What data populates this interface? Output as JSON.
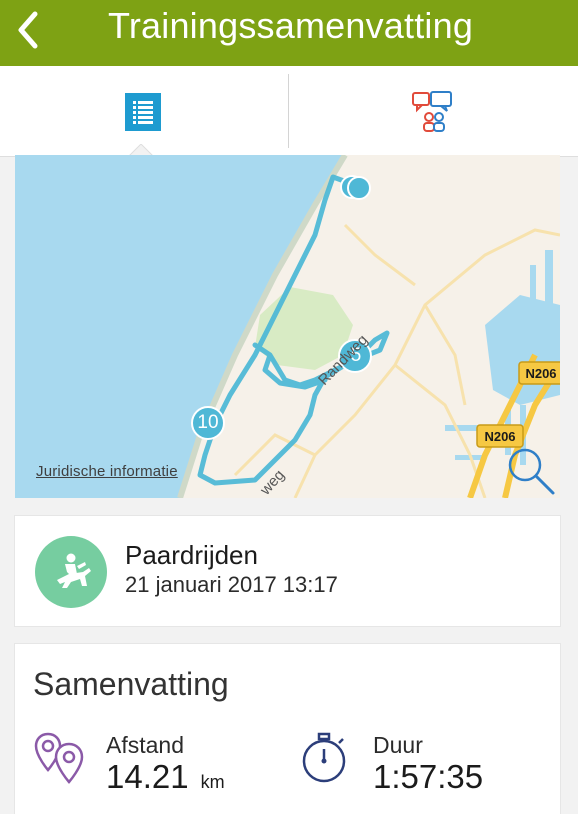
{
  "header": {
    "title": "Trainingssamenvatting",
    "back_icon": "chevron-left-icon",
    "background": "#7ea214"
  },
  "tabs": [
    {
      "name": "summary",
      "icon": "list-icon",
      "active": true
    },
    {
      "name": "social",
      "icon": "chat-people-icon",
      "active": false
    }
  ],
  "map": {
    "legal_label": "Juridische informatie",
    "road_labels": [
      "Randweg",
      "weg"
    ],
    "shields": [
      "N206",
      "N206"
    ],
    "markers": [
      "5",
      "10"
    ],
    "route_color": "#4fb8d6",
    "sea_color": "#a8d9ef"
  },
  "activity": {
    "name": "Paardrijden",
    "date": "21 januari 2017 13:17",
    "icon": "horse-riding-icon"
  },
  "summary": {
    "title": "Samenvatting",
    "metrics": [
      {
        "label": "Afstand",
        "value": "14.21",
        "unit": "km",
        "icon": "location-pins-icon"
      },
      {
        "label": "Duur",
        "value": "1:57:35",
        "unit": "",
        "icon": "stopwatch-icon"
      }
    ]
  }
}
